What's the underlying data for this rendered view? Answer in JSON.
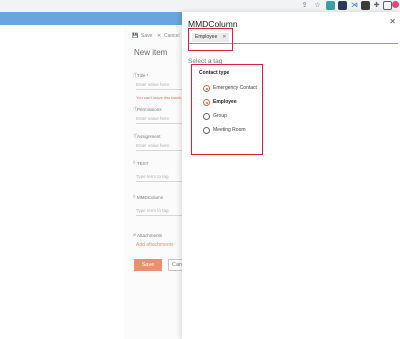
{
  "browser": {
    "icons": [
      "share-icon",
      "star-icon",
      "extension-icon",
      "extension-icon",
      "extension-icon",
      "extension-icon",
      "puzzle-icon",
      "sidebar-icon",
      "avatar",
      "more-icon"
    ]
  },
  "form": {
    "save_cmd": "Save",
    "cancel_cmd": "Cancel",
    "title": "New item",
    "fields": [
      {
        "label": "Title *",
        "placeholder": "Enter value here",
        "error": "You can't leave this blank."
      },
      {
        "label": "Permissions",
        "placeholder": "Enter value here"
      },
      {
        "label": "Assignment",
        "placeholder": "Enter value here"
      },
      {
        "label": "TEST",
        "placeholder": "Type term to tag"
      },
      {
        "label": "MMDColumn",
        "placeholder": "Type term to tag"
      }
    ],
    "attachments_label": "Attachments",
    "add_attachments": "Add attachments",
    "save_button": "Save",
    "cancel_button": "Cancel"
  },
  "picker": {
    "title": "MMDColumn",
    "selected_tag": "Employee",
    "select_label": "Select a tag",
    "group_title": "Contact type",
    "options": [
      {
        "label": "Emergency Contact",
        "selected": true,
        "bold": false
      },
      {
        "label": "Employee",
        "selected": true,
        "bold": true
      },
      {
        "label": "Group",
        "selected": false,
        "bold": false
      },
      {
        "label": "Meeting Room",
        "selected": false,
        "bold": false
      }
    ]
  },
  "colors": {
    "accent": "#e06a3e",
    "annotation": "#e0203a",
    "app_bar": "#6aa5dd"
  }
}
